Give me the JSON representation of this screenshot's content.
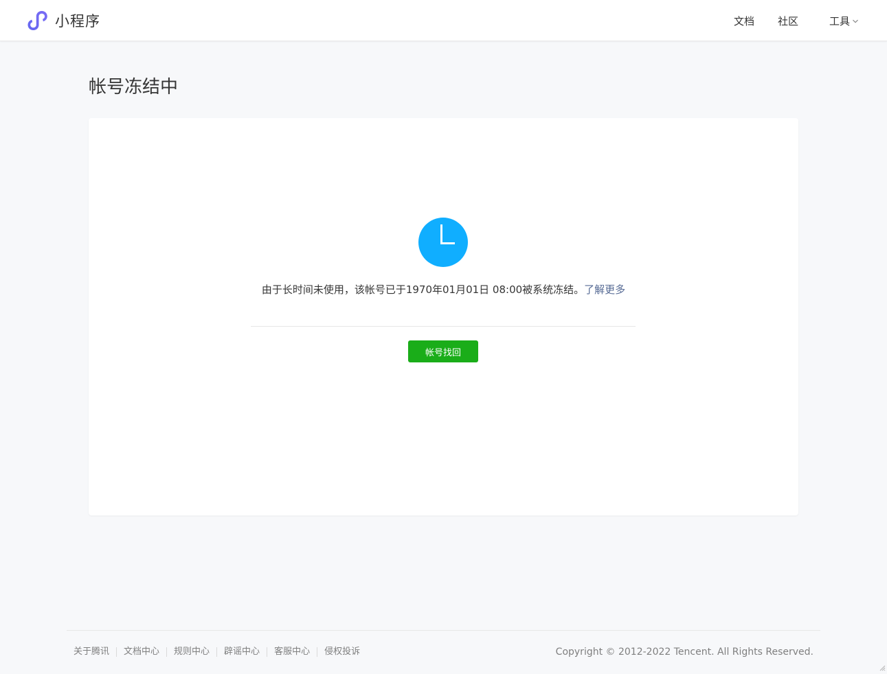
{
  "header": {
    "logo_text": "小程序",
    "logo_icon": "miniprogram-logo-icon",
    "nav": {
      "docs": "文档",
      "community": "社区",
      "tools": "工具"
    }
  },
  "page": {
    "title": "帐号冻结中"
  },
  "status": {
    "icon": "clock-icon",
    "icon_color": "#10aeff",
    "message": "由于长时间未使用，该帐号已于1970年01月01日 08:00被系统冻结。",
    "learn_more": "了解更多",
    "button_label": "帐号找回",
    "button_color": "#1aad19"
  },
  "footer": {
    "links": [
      "关于腾讯",
      "文档中心",
      "规则中心",
      "辟谣中心",
      "客服中心",
      "侵权投诉"
    ],
    "copyright": "Copyright © 2012-2022 Tencent. All Rights Reserved."
  }
}
